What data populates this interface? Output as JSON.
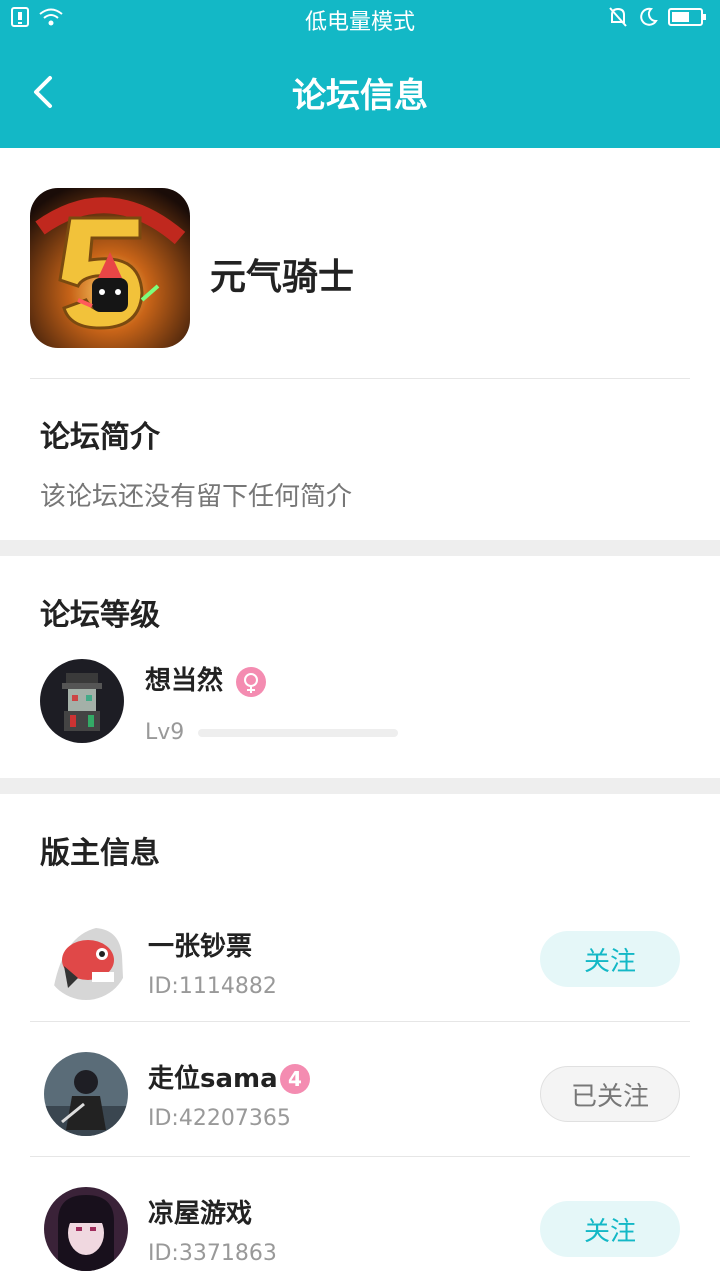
{
  "status_bar": {
    "center_text": "低电量模式"
  },
  "header": {
    "title": "论坛信息",
    "back_icon": "back-arrow-icon"
  },
  "game": {
    "name": "元气骑士"
  },
  "intro": {
    "title": "论坛简介",
    "text": "该论坛还没有留下任何简介"
  },
  "level": {
    "title": "论坛等级",
    "user_name": "想当然",
    "level_text": "Lv9",
    "progress": 0
  },
  "moderators": {
    "title": "版主信息",
    "items": [
      {
        "name": "一张钞票",
        "id": "ID:1114882",
        "button": "关注"
      },
      {
        "name": "走位sama",
        "id": "ID:42207365",
        "button": "已关注",
        "badge": "4"
      },
      {
        "name": "凉屋游戏",
        "id": "ID:3371863",
        "button": "关注"
      }
    ]
  },
  "colors": {
    "accent": "#13b8c6",
    "badge": "#f48cb1"
  }
}
